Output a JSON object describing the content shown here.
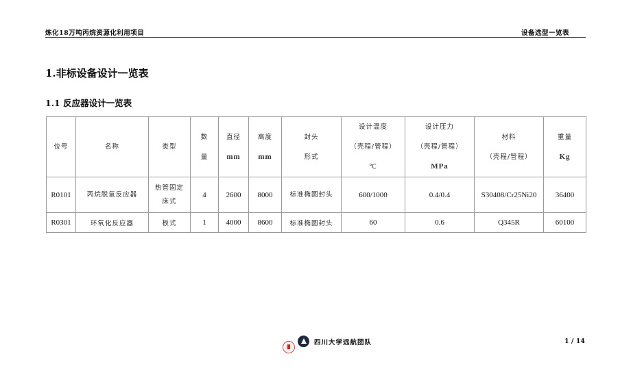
{
  "header": {
    "project": "炼化18万吨丙烷资源化利用项目",
    "doc_title": "设备选型一览表"
  },
  "section": {
    "h1": "1.非标设备设计一览表",
    "h2": "1.1 反应器设计一览表"
  },
  "table": {
    "headers": [
      [
        "位号"
      ],
      [
        "名称"
      ],
      [
        "类型"
      ],
      [
        "数",
        "量"
      ],
      [
        "直径",
        "mm"
      ],
      [
        "高度",
        "mm"
      ],
      [
        "封头",
        "形式"
      ],
      [
        "设计温度",
        "（壳程/管程）",
        "℃"
      ],
      [
        "设计压力",
        "（壳程/管程）",
        "MPa"
      ],
      [
        "材料",
        "（壳程/管程）"
      ],
      [
        "重量",
        "Kg"
      ]
    ],
    "rows": [
      {
        "tag": "R0101",
        "name": "丙烷脱氢反应器",
        "type_lines": [
          "热管固定",
          "床式"
        ],
        "qty": "4",
        "diameter": "2600",
        "height": "8000",
        "head": "标准椭圆封头",
        "temp": "600/1000",
        "pressure": "0.4/0.4",
        "material": "S30408/Cr25Ni20",
        "weight": "36400"
      },
      {
        "tag": "R0301",
        "name": "环氧化反应器",
        "type_lines": [
          "板式"
        ],
        "qty": "1",
        "diameter": "4000",
        "height": "8600",
        "head": "标准椭圆封头",
        "temp": "60",
        "pressure": "0.6",
        "material": "Q345R",
        "weight": "60100"
      }
    ]
  },
  "footer": {
    "team": "四川大学远航团队",
    "page": "1 / 14",
    "icons": [
      "university-seal-icon",
      "team-sail-logo-icon"
    ]
  }
}
